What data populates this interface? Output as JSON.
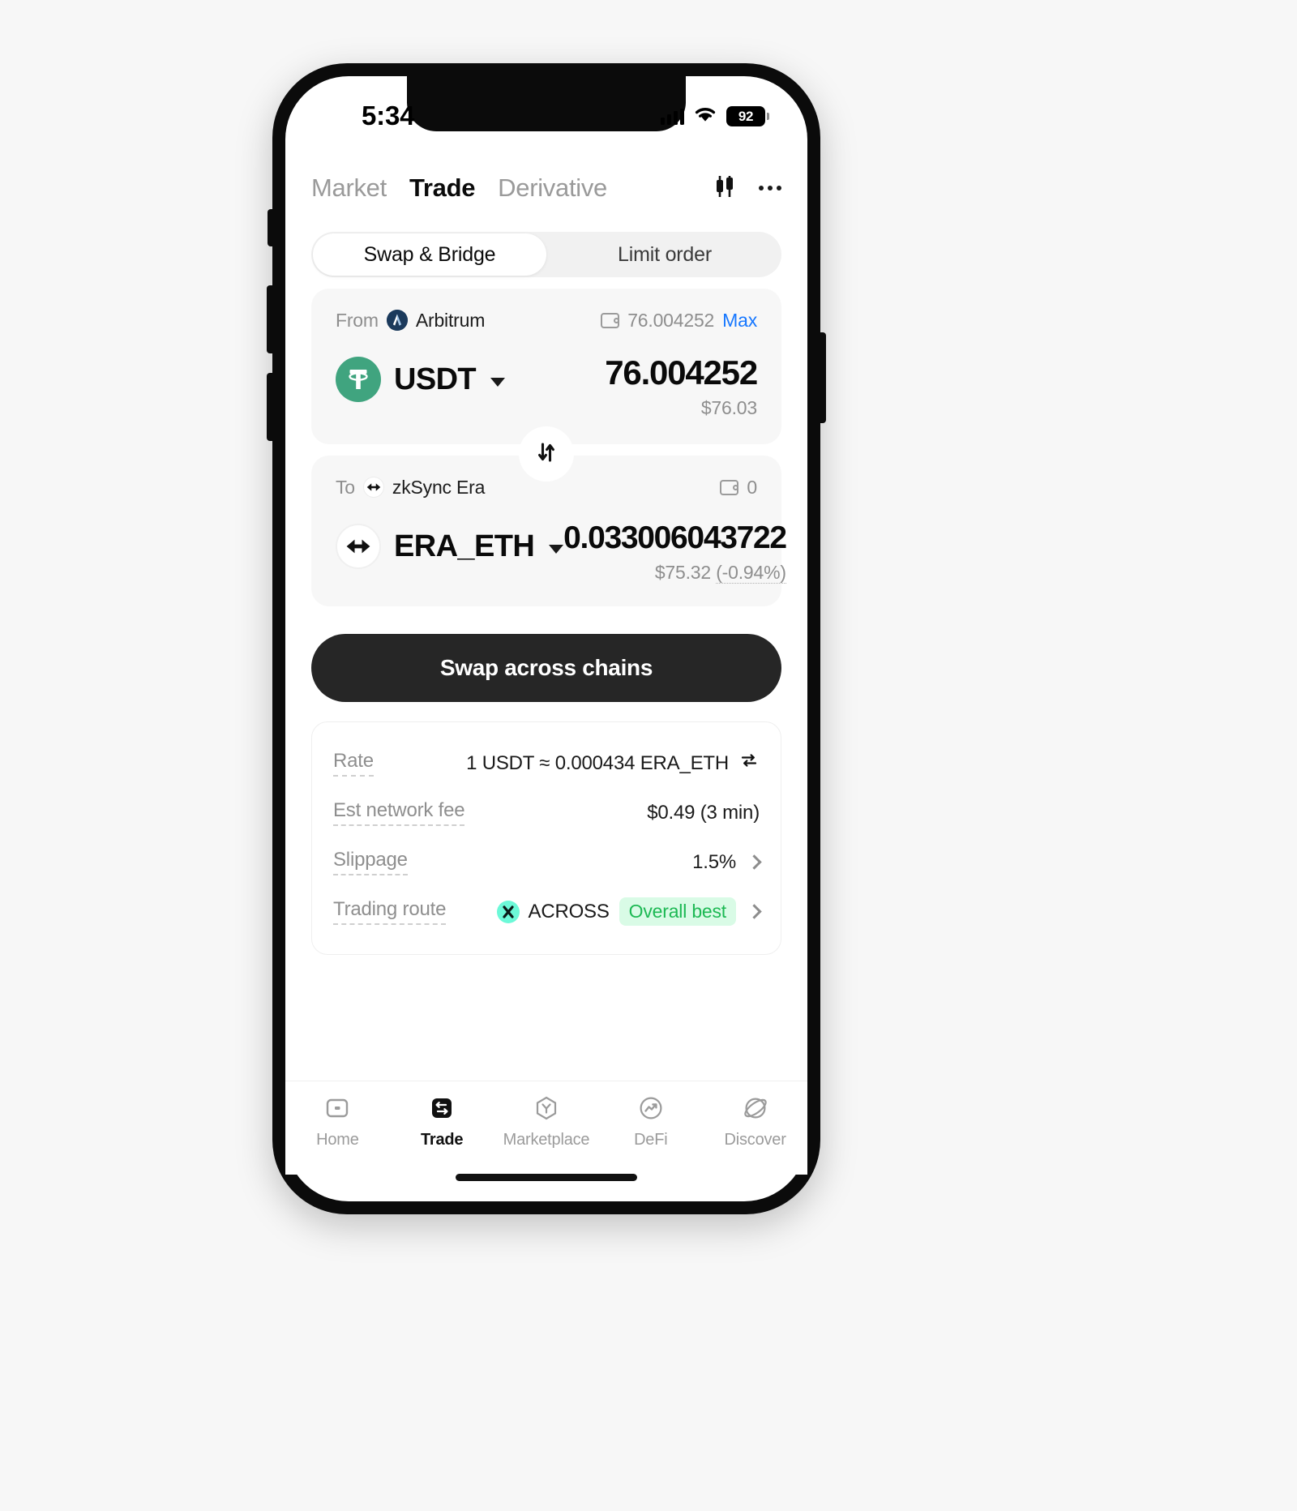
{
  "status_bar": {
    "time": "5:34",
    "signal_icon": "signal-bars-icon",
    "wifi_icon": "wifi-icon",
    "battery_level": "92"
  },
  "top_nav": {
    "tabs": [
      {
        "label": "Market",
        "active": false
      },
      {
        "label": "Trade",
        "active": true
      },
      {
        "label": "Derivative",
        "active": false
      }
    ],
    "chart_icon": "candlestick-chart-icon",
    "more_icon": "more-options-icon"
  },
  "mode_tabs": {
    "options": [
      {
        "label": "Swap & Bridge",
        "active": true
      },
      {
        "label": "Limit order",
        "active": false
      }
    ]
  },
  "from_card": {
    "label": "From",
    "chain": "Arbitrum",
    "chain_logo": "arbitrum-logo-icon",
    "wallet_icon": "wallet-icon",
    "balance": "76.004252",
    "max_label": "Max",
    "token_symbol": "USDT",
    "token_logo": "tether-logo-icon",
    "amount": "76.004252",
    "fiat_value": "$76.03"
  },
  "swap_toggle": {
    "icon": "swap-vertical-icon"
  },
  "to_card": {
    "label": "To",
    "chain": "zkSync Era",
    "chain_logo": "zksync-logo-icon",
    "wallet_icon": "wallet-icon",
    "balance": "0",
    "token_symbol": "ERA_ETH",
    "token_logo": "zksync-era-eth-logo-icon",
    "amount": "0.033006043722",
    "fiat_value": "$75.32",
    "fiat_change": "(-0.94%)"
  },
  "cta": {
    "label": "Swap across chains"
  },
  "details": {
    "rows": [
      {
        "label": "Rate",
        "value": "1 USDT ≈ 0.000434 ERA_ETH",
        "trailing_icon": "refresh-swap-icon"
      },
      {
        "label": "Est network fee",
        "value": "$0.49 (3 min)",
        "trailing_icon": ""
      },
      {
        "label": "Slippage",
        "value": "1.5%",
        "trailing_icon": "chevron-right-icon"
      },
      {
        "label": "Trading route",
        "value": "ACROSS",
        "badge": "Overall best",
        "route_logo": "across-logo-icon",
        "trailing_icon": "chevron-right-icon"
      }
    ]
  },
  "bottom_nav": {
    "items": [
      {
        "label": "Home",
        "icon": "home-icon",
        "active": false
      },
      {
        "label": "Trade",
        "icon": "trade-swap-icon",
        "active": true
      },
      {
        "label": "Marketplace",
        "icon": "marketplace-hexagon-icon",
        "active": false
      },
      {
        "label": "DeFi",
        "icon": "defi-trending-icon",
        "active": false
      },
      {
        "label": "Discover",
        "icon": "discover-planet-icon",
        "active": false
      }
    ]
  },
  "colors": {
    "accent_blue": "#1677ff",
    "cta_dark": "#262626",
    "tether_green": "#40a47f",
    "badge_green_text": "#1db954",
    "badge_green_bg": "#d9fbe6",
    "across_teal": "#6cf9d8"
  }
}
